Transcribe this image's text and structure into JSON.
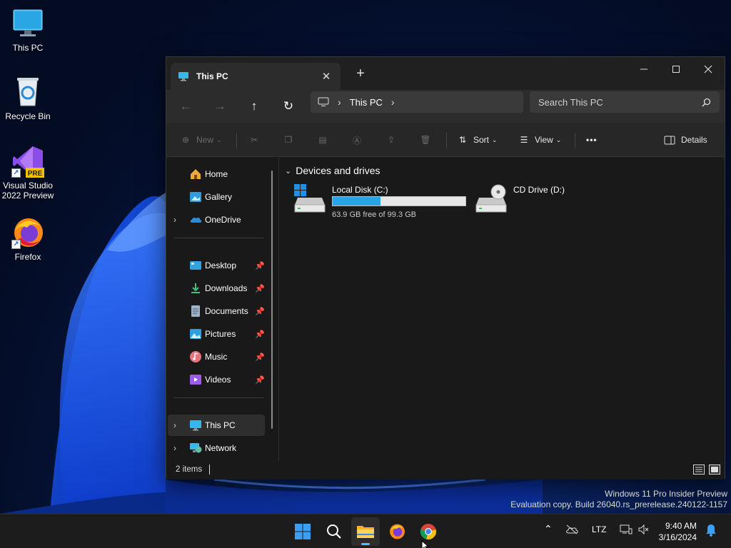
{
  "desktop": {
    "icons": [
      {
        "label": "This PC"
      },
      {
        "label": "Recycle Bin"
      },
      {
        "label_line1": "Visual Studio",
        "label_line2": "2022 Preview",
        "badge": "PRE"
      },
      {
        "label": "Firefox"
      }
    ]
  },
  "window": {
    "tab_title": "This PC",
    "address": {
      "crumb": "This PC"
    },
    "search": {
      "placeholder": "Search This PC"
    },
    "commands": {
      "new": "New",
      "sort": "Sort",
      "view": "View",
      "more": "•••",
      "details": "Details"
    },
    "sidebar": {
      "items": [
        {
          "label": "Home"
        },
        {
          "label": "Gallery"
        },
        {
          "label": "OneDrive"
        },
        {
          "label": "Desktop",
          "pinned": true
        },
        {
          "label": "Downloads",
          "pinned": true
        },
        {
          "label": "Documents",
          "pinned": true
        },
        {
          "label": "Pictures",
          "pinned": true
        },
        {
          "label": "Music",
          "pinned": true
        },
        {
          "label": "Videos",
          "pinned": true
        },
        {
          "label": "This PC",
          "selected": true
        },
        {
          "label": "Network"
        }
      ]
    },
    "content": {
      "group_header": "Devices and drives",
      "drives": [
        {
          "name": "Local Disk (C:)",
          "free_text": "63.9 GB free of 99.3 GB",
          "used_fraction": 0.36
        },
        {
          "name": "CD Drive (D:)"
        }
      ]
    },
    "status": {
      "items_text": "2 items"
    }
  },
  "watermark": {
    "line1": "Windows 11 Pro Insider Preview",
    "line2": "Evaluation copy. Build 26040.rs_prerelease.240122-1157"
  },
  "taskbar": {
    "apps": [
      "start-icon",
      "search-icon",
      "file-explorer-icon",
      "firefox-icon",
      "chrome-icon"
    ],
    "active_app": "file-explorer-icon",
    "tray": {
      "language": "LTZ",
      "time": "9:40 AM",
      "date": "3/16/2024"
    }
  },
  "colors": {
    "accent": "#27a3e6",
    "window_bg": "#191919",
    "taskbar_bg": "#1c1c1c"
  }
}
